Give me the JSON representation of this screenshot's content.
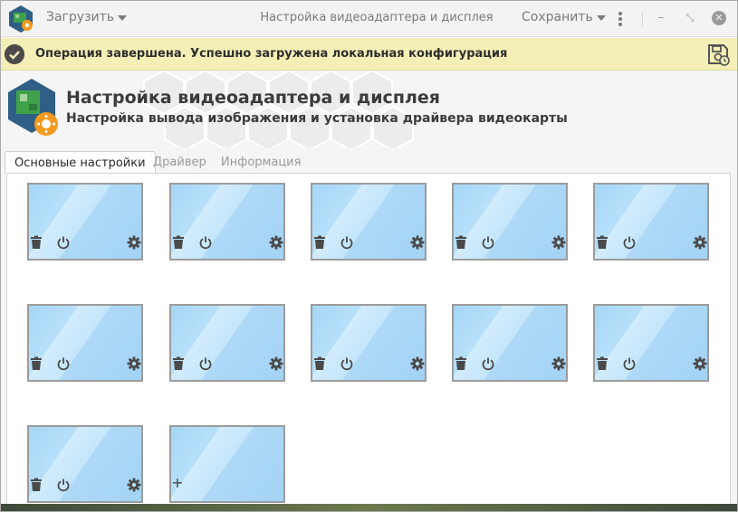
{
  "titlebar": {
    "load_label": "Загрузить",
    "title": "Настройка видеоадаптера и дисплея",
    "save_label": "Сохранить"
  },
  "notification": {
    "text": "Операция завершена. Успешно загружена локальная конфигурация"
  },
  "header": {
    "title": "Настройка видеоадаптера и дисплея",
    "subtitle": "Настройка вывода изображения и установка драйвера видеокарты"
  },
  "tabs": [
    {
      "label": "Основные настройки",
      "active": true
    },
    {
      "label": "Драйвер",
      "active": false
    },
    {
      "label": "Информация",
      "active": false
    }
  ],
  "monitors": {
    "count": 11,
    "add_label": "+"
  },
  "colors": {
    "notification_bg": "#f3efb6",
    "monitor_fill": "#b7e0fa",
    "accent_orange": "#f39a1e"
  }
}
